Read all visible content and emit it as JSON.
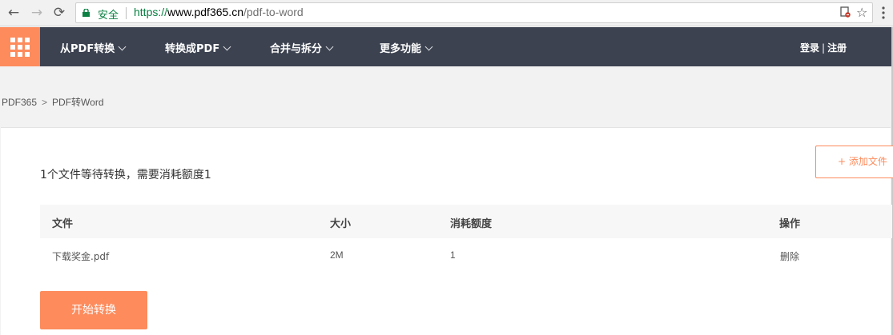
{
  "browser": {
    "back_icon": "arrow-left-icon",
    "forward_icon": "arrow-right-icon",
    "reload_icon": "reload-icon",
    "secure_label": "安全",
    "url_protocol": "https://",
    "url_host": "www.pdf365.cn",
    "url_path": "/pdf-to-word",
    "blocked_icon": "popup-blocked-icon",
    "bookmark_icon": "star-icon",
    "menu_icon": "kebab-menu-icon"
  },
  "header": {
    "logo_icon": "app-grid-icon",
    "nav": [
      {
        "label": "从PDF转换"
      },
      {
        "label": "转换成PDF"
      },
      {
        "label": "合并与拆分"
      },
      {
        "label": "更多功能"
      }
    ],
    "login": "登录",
    "divider": "|",
    "register": "注册"
  },
  "breadcrumb": {
    "home": "PDF365",
    "separator": ">",
    "current": "PDF转Word"
  },
  "main": {
    "summary": "1个文件等待转换，需要消耗额度1",
    "add_file": "+ 添加文件",
    "table": {
      "headers": [
        "文件",
        "大小",
        "消耗额度",
        "操作"
      ],
      "rows": [
        {
          "file": "下载奖金.pdf",
          "size": "2M",
          "credits": "1",
          "action": "删除"
        }
      ]
    },
    "start_button": "开始转换"
  },
  "colors": {
    "accent": "#fd8b5c",
    "nav_bg": "#3c4250",
    "secure_green": "#0b8043"
  }
}
